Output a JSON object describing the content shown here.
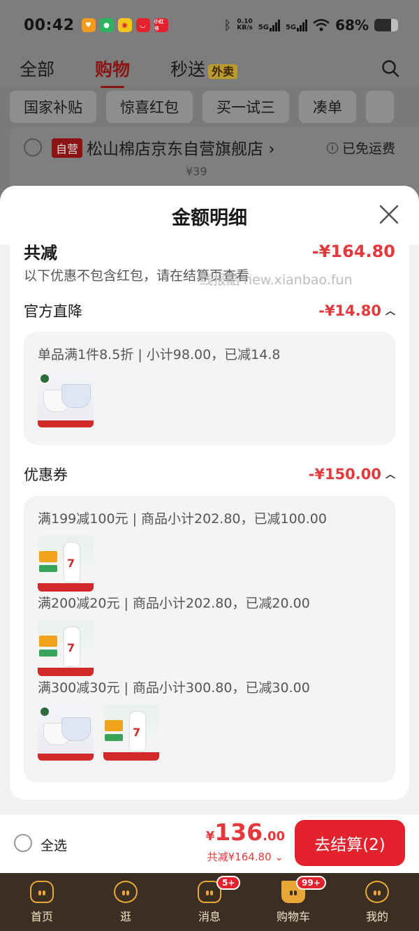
{
  "status_bar": {
    "time": "00:42",
    "net_speed_value": "0.10",
    "net_speed_unit": "KB/s",
    "sig1": "5G",
    "sig2": "5G",
    "battery": "68%"
  },
  "top_nav": {
    "tabs": [
      "全部",
      "购物",
      "秒送"
    ],
    "active_index": 1,
    "badge": "外卖"
  },
  "chips": [
    "国家补贴",
    "惊喜红包",
    "买一试三",
    "凑单"
  ],
  "store": {
    "tag": "自营",
    "name": "松山棉店京东自营旗舰店",
    "arrow": "›",
    "shipping": "已免运费",
    "price": "¥39"
  },
  "sheet": {
    "title": "金额明细",
    "total_label": "共减",
    "total_amount": "-¥164.80",
    "note": "以下优惠不包含红包，请在结算页查看",
    "watermark": "线报酷 new.xianbao.fun",
    "sections": [
      {
        "label": "官方直降",
        "amount": "-¥14.80",
        "lines": [
          "单品满1件8.5折 | 小计98.00，已减14.8"
        ]
      },
      {
        "label": "优惠券",
        "amount": "-¥150.00",
        "lines": [
          "满199减100元 | 商品小计202.80，已减100.00",
          "满200减20元 | 商品小计202.80，已减20.00",
          "满300减30元 | 商品小计300.80，已减30.00"
        ]
      }
    ]
  },
  "bottom_bar": {
    "select_all": "全选",
    "currency": "¥",
    "price_int": "136",
    "price_dec": ".00",
    "saved": "共减¥164.80",
    "checkout": "去结算(2)"
  },
  "tab_bar": {
    "items": [
      {
        "label": "首页"
      },
      {
        "label": "逛"
      },
      {
        "label": "消息",
        "badge": "5+"
      },
      {
        "label": "购物车",
        "badge": "99+"
      },
      {
        "label": "我的"
      }
    ]
  },
  "colors": {
    "accent_red": "#e4393c",
    "tabbar_bg": "#3b2f24",
    "icon_gold": "#e9a738"
  }
}
